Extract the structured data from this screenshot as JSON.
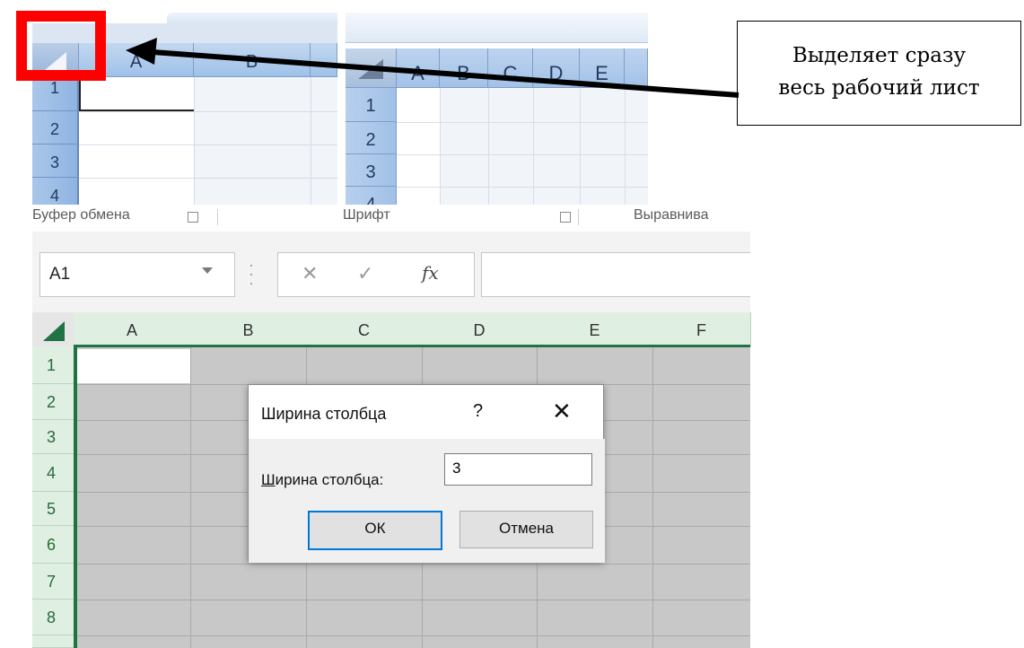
{
  "old_excel_1": {
    "columns": [
      "A",
      "B"
    ],
    "rows": [
      "1",
      "2",
      "3",
      "4"
    ]
  },
  "old_excel_2": {
    "columns": [
      "A",
      "B",
      "C",
      "D",
      "E"
    ],
    "rows": [
      "1",
      "2",
      "3",
      "4"
    ]
  },
  "callout": {
    "line1": "Выделяет сразу",
    "line2": "весь рабочий лист",
    "highlight_color": "#ff0000"
  },
  "ribbon": {
    "groups": [
      "Буфер обмена",
      "Шрифт",
      "Выравнива"
    ]
  },
  "formula_bar": {
    "name_box": "A1",
    "cancel_icon": "✕",
    "enter_icon": "✓",
    "fx_icon": "fx",
    "value": ""
  },
  "sheet": {
    "columns": [
      "A",
      "B",
      "C",
      "D",
      "E",
      "F"
    ],
    "rows": [
      "1",
      "2",
      "3",
      "4",
      "5",
      "6",
      "7",
      "8"
    ],
    "accent": "#217346"
  },
  "dialog": {
    "title": "Ширина столбца",
    "help": "?",
    "close": "✕",
    "field_label_accel": "Ш",
    "field_label_rest": "ирина столбца:",
    "field_value": "3",
    "ok_label": "ОК",
    "cancel_label": "Отмена"
  }
}
